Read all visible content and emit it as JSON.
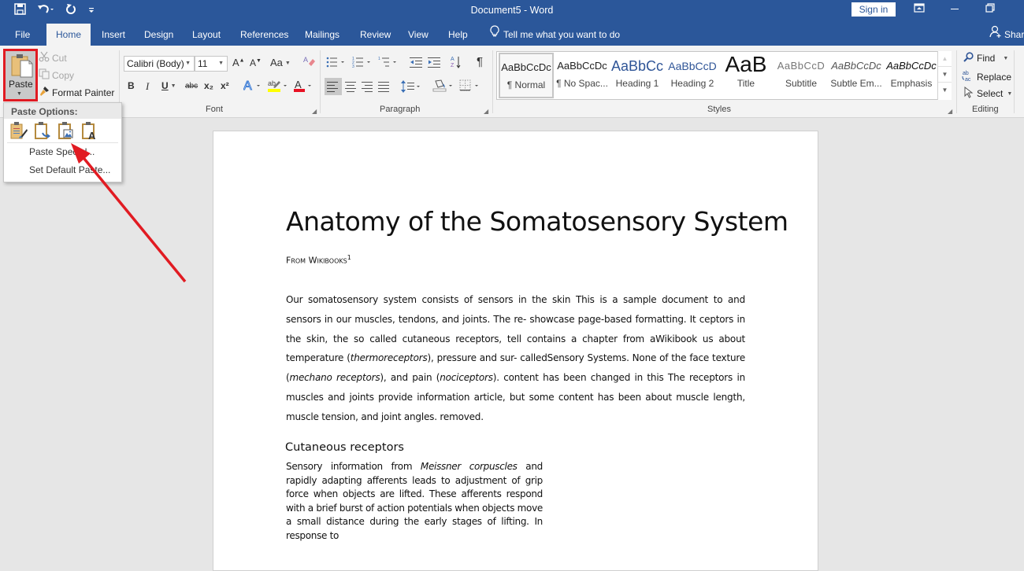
{
  "window": {
    "title": "Document5  -  Word",
    "sign_in": "Sign in",
    "qat": {
      "save": "save-icon",
      "undo": "undo-icon",
      "redo": "redo-icon",
      "customize": "customize-qat-icon"
    },
    "controls": {
      "ribbon_display": "ribbon-display-options-icon",
      "minimize": "minimize-icon",
      "restore": "restore-icon"
    }
  },
  "tabs": [
    {
      "label": "File"
    },
    {
      "label": "Home",
      "active": true
    },
    {
      "label": "Insert"
    },
    {
      "label": "Design"
    },
    {
      "label": "Layout"
    },
    {
      "label": "References"
    },
    {
      "label": "Mailings"
    },
    {
      "label": "Review"
    },
    {
      "label": "View"
    },
    {
      "label": "Help"
    }
  ],
  "tell_me": "Tell me what you want to do",
  "share": "Share",
  "clipboard": {
    "paste": "Paste",
    "cut": "Cut",
    "copy": "Copy",
    "format_painter": "Format Painter"
  },
  "font": {
    "label": "Font",
    "family": "Calibri (Body)",
    "size": "11",
    "change_case": "Aa",
    "bold": "B",
    "italic": "I",
    "underline": "U",
    "strikethrough": "abc",
    "subscript": "x₂",
    "superscript": "x²",
    "font_color": "#e81123",
    "highlight_color": "#ffff00"
  },
  "paragraph": {
    "label": "Paragraph"
  },
  "styles": {
    "label": "Styles",
    "items": [
      {
        "preview": "AaBbCcDc",
        "label": "¶ Normal",
        "selected": true
      },
      {
        "preview": "AaBbCcDc",
        "label": "¶ No Spac..."
      },
      {
        "preview": "AaBbCc",
        "label": "Heading 1"
      },
      {
        "preview": "AaBbCcD",
        "label": "Heading 2"
      },
      {
        "preview": "AaB",
        "label": "Title"
      },
      {
        "preview": "AaBbCcD",
        "label": "Subtitle"
      },
      {
        "preview": "AaBbCcDc",
        "label": "Subtle Em..."
      },
      {
        "preview": "AaBbCcDc",
        "label": "Emphasis"
      }
    ]
  },
  "editing": {
    "label": "Editing",
    "find": "Find",
    "replace": "Replace",
    "select": "Select"
  },
  "paste_menu": {
    "header": "Paste Options:",
    "options": [
      "keep-source-formatting",
      "merge-formatting",
      "picture",
      "keep-text-only"
    ],
    "paste_special": "Paste Special...",
    "set_default": "Set Default Paste..."
  },
  "document": {
    "title": "Anatomy of the Somatosensory System",
    "subtitle": "From Wikibooks",
    "footnote_ref": "1",
    "paragraph1": {
      "p1": "Our somatosensory system consists of sensors in the skin This is a sample document to and sensors in our muscles, tendons, and joints. The re- showcase page-based formatting. It ceptors in the skin, the so called cutaneous receptors, tell contains a chapter from aWikibook us about temperature (",
      "i1": "thermoreceptors",
      "p2": "), pressure and sur- calledSensory Systems. None of the face texture (",
      "i2": "mechano receptors",
      "p3": "), and pain (",
      "i3": "nociceptors",
      "p4": "). content has been changed in this The receptors in muscles and joints provide information article, but some content has been about muscle length, muscle tension, and joint angles. removed."
    },
    "heading2": "Cutaneous receptors",
    "paragraph2": {
      "p1": "Sensory information from ",
      "i1": "Meissner corpuscles",
      "p2": " and rapidly adapting afferents leads to adjustment of grip force when objects are lifted. These afferents respond with a brief burst of action potentials when objects move a small distance during the early stages of lifting. In response to"
    }
  },
  "annotation": {
    "color": "#e11b22"
  }
}
